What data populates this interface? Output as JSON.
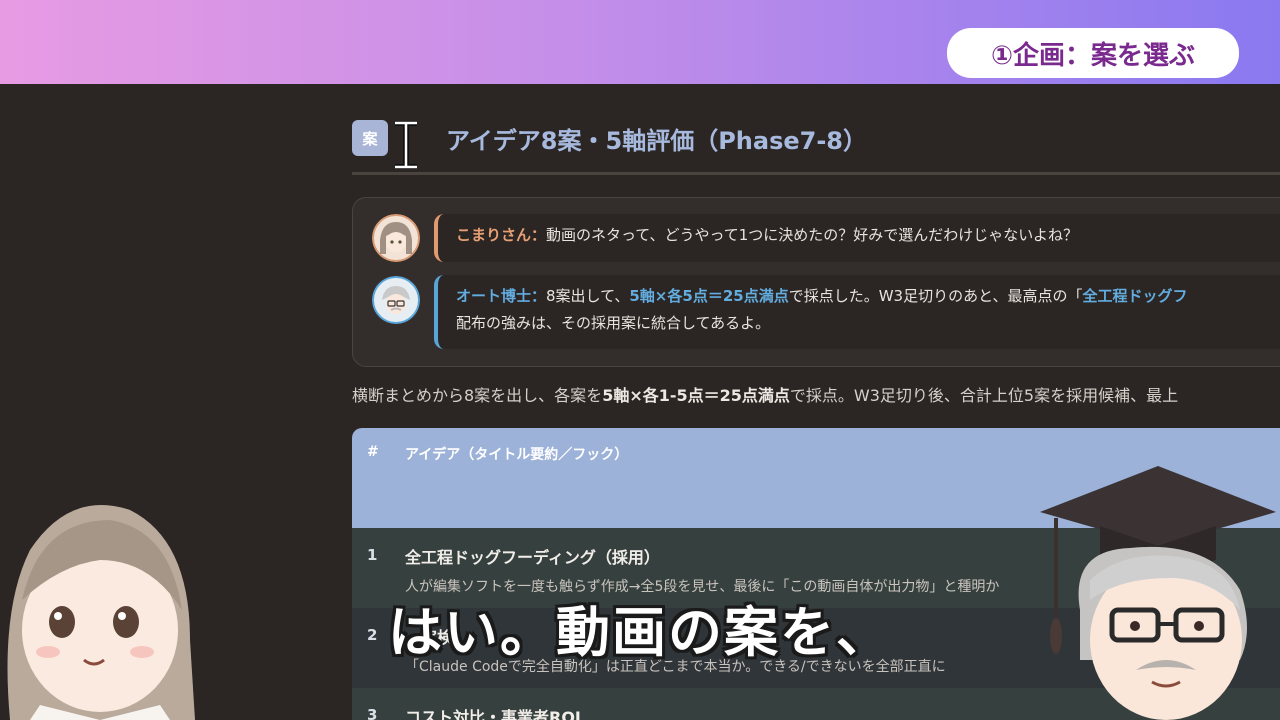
{
  "badge": "①企画：案を選ぶ",
  "heading": {
    "icon_label": "案",
    "title": "アイデア8案・5軸評価（Phase7-8）"
  },
  "dialogue": [
    {
      "speaker": "こまりさん：",
      "text": "動画のネタって、どうやって1つに決めたの？好みで選んだわけじゃないよね？"
    },
    {
      "speaker": "オート博士：",
      "text_a": "8案出して、",
      "emphasis": "5軸×各5点＝25点満点",
      "text_b": "で採点した。W3足切りのあと、最高点の「",
      "emphasis_b": "全工程ドッグフ",
      "line2": "配布の強みは、その採用案に統合してあるよ。"
    }
  ],
  "summary": {
    "pre": "横断まとめから8案を出し、各案を",
    "bold": "5軸×各1-5点＝25点満点",
    "post": "で採点。W3足切り後、合計上位5案を採用候補、最上"
  },
  "table": {
    "headers": [
      "#",
      "アイデア（タイトル要約／フック）"
    ],
    "rows": [
      {
        "num": "1",
        "title": "全工程ドッグフーディング（採用）",
        "sub": "人が編集ソフトを一度も触らず作成→全5段を見せ、最後に「この動画自体が出力物」と種明か"
      },
      {
        "num": "2",
        "title": "…実検",
        "sub": "「Claude Codeで完全自動化」は正直どこまで本当か。できる/できないを全部正直に"
      },
      {
        "num": "3",
        "title": "コスト対比・事業者ROI",
        "sub": ""
      }
    ]
  },
  "caption": "はい。動画の案を、",
  "colors": {
    "accent_blue": "#62acdf",
    "accent_orange": "#e7a074",
    "header_blue": "#9db2d8"
  }
}
